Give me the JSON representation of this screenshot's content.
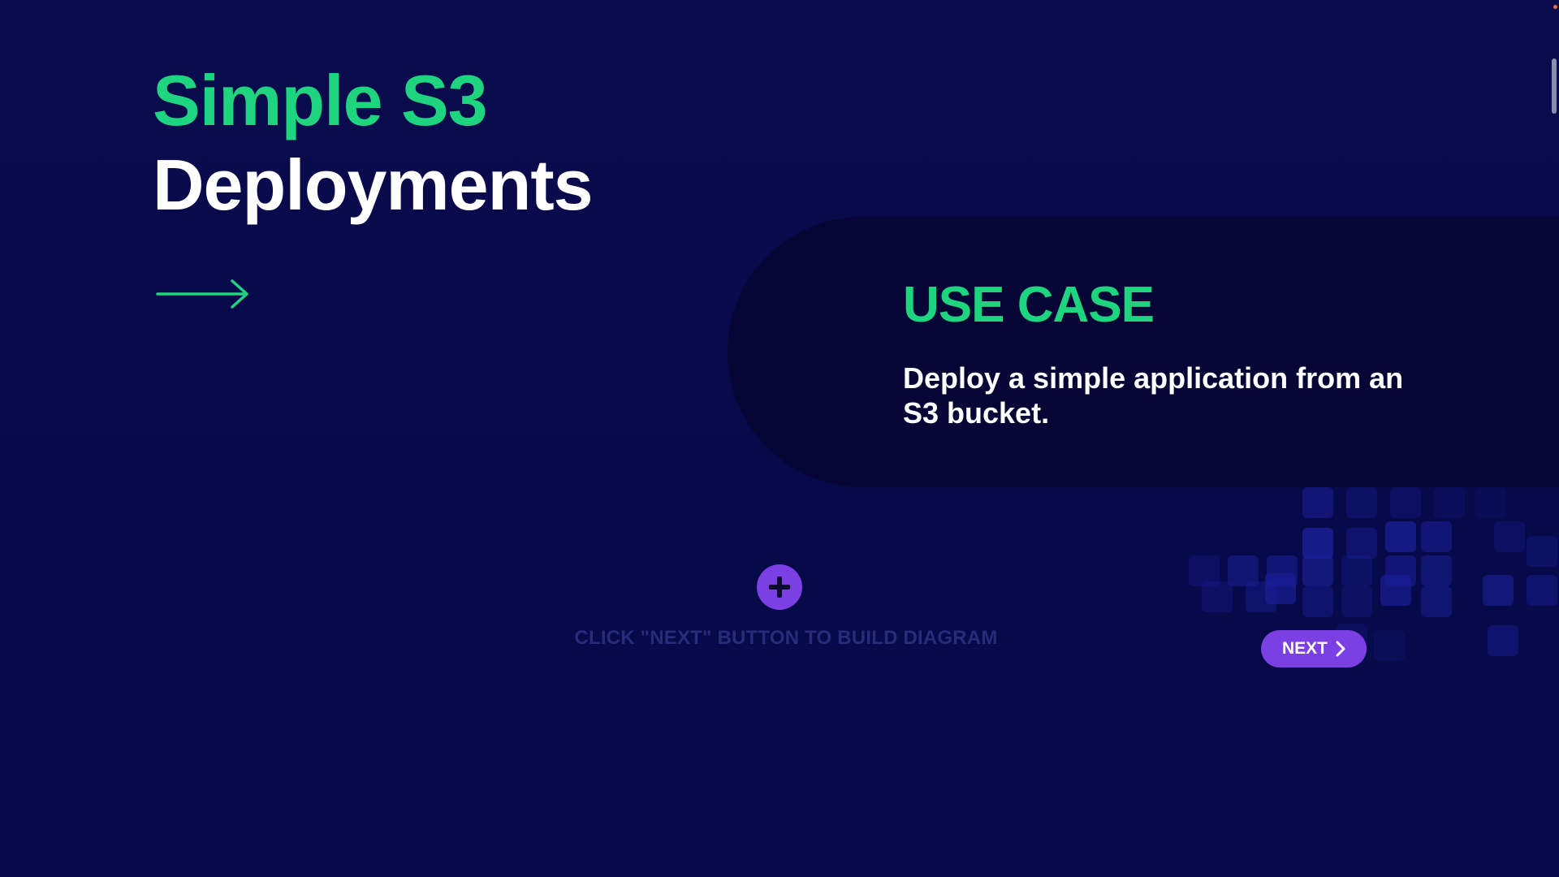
{
  "header": {
    "title_line1": "Simple S3",
    "title_line2": "Deployments"
  },
  "use_case": {
    "heading": "USE CASE",
    "description": "Deploy a simple application from an S3 bucket."
  },
  "diagram": {
    "hint": "CLICK \"NEXT\" BUTTON TO BUILD DIAGRAM"
  },
  "controls": {
    "next_label": "NEXT"
  },
  "icons": {
    "arrow": "arrow-right-icon",
    "add": "plus-icon",
    "next": "chevron-right-icon"
  },
  "colors": {
    "background": "#090b4a",
    "accent_green": "#1fd47f",
    "accent_purple": "#7b3fe4",
    "panel": "#050636",
    "hint_text": "#282b7a"
  }
}
